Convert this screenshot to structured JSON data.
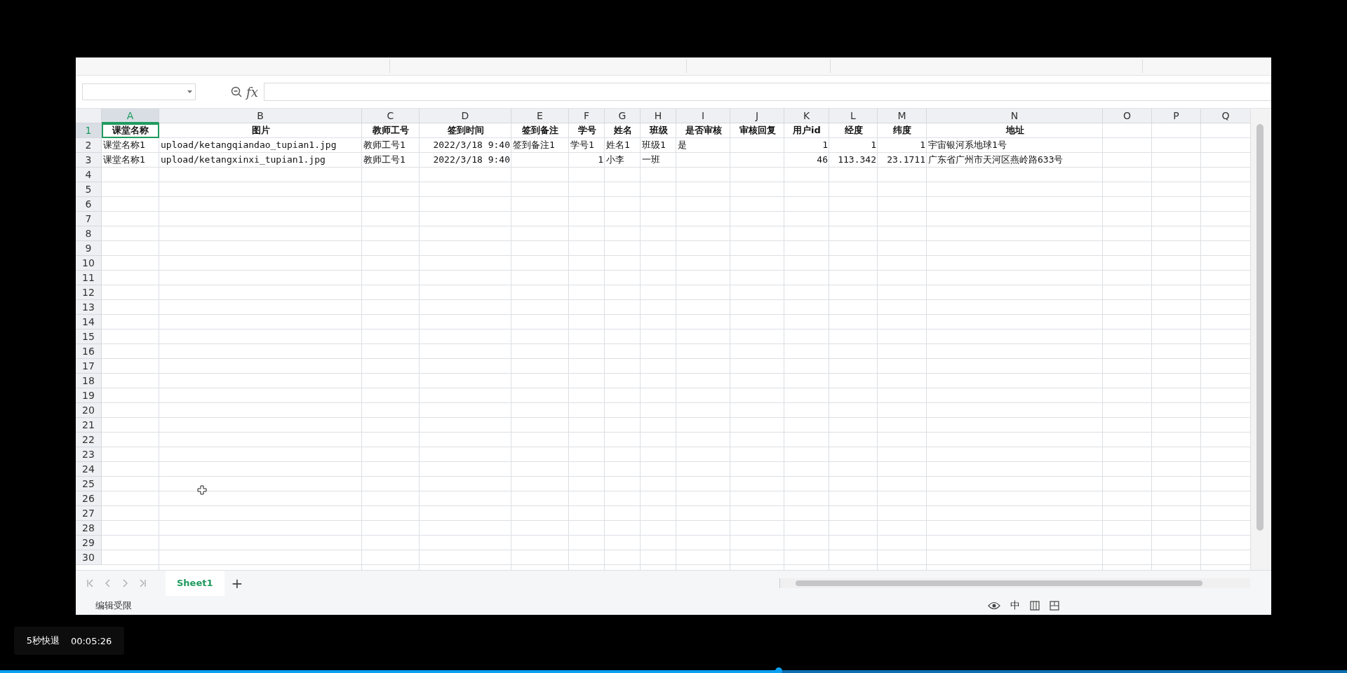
{
  "formula_bar": {
    "fx_label": "fx"
  },
  "sheet": {
    "columns": [
      {
        "letter": "A",
        "selected": true
      },
      {
        "letter": "B",
        "selected": false
      },
      {
        "letter": "C",
        "selected": false
      },
      {
        "letter": "D",
        "selected": false
      },
      {
        "letter": "E",
        "selected": false
      },
      {
        "letter": "F",
        "selected": false
      },
      {
        "letter": "G",
        "selected": false
      },
      {
        "letter": "H",
        "selected": false
      },
      {
        "letter": "I",
        "selected": false
      },
      {
        "letter": "J",
        "selected": false
      },
      {
        "letter": "K",
        "selected": false
      },
      {
        "letter": "L",
        "selected": false
      },
      {
        "letter": "M",
        "selected": false
      },
      {
        "letter": "N",
        "selected": false
      },
      {
        "letter": "O",
        "selected": false
      },
      {
        "letter": "P",
        "selected": false
      },
      {
        "letter": "Q",
        "selected": false
      }
    ],
    "rows": [
      {
        "number": "1",
        "selected": true,
        "cells": [
          {
            "text": "课堂名称",
            "kind": "header",
            "selected": true
          },
          {
            "text": "图片",
            "kind": "header",
            "selected": false
          },
          {
            "text": "教师工号",
            "kind": "header",
            "selected": false
          },
          {
            "text": "签到时间",
            "kind": "header",
            "selected": false
          },
          {
            "text": "签到备注",
            "kind": "header",
            "selected": false
          },
          {
            "text": "学号",
            "kind": "header",
            "selected": false
          },
          {
            "text": "姓名",
            "kind": "header",
            "selected": false
          },
          {
            "text": "班级",
            "kind": "header",
            "selected": false
          },
          {
            "text": "是否审核",
            "kind": "header",
            "selected": false
          },
          {
            "text": "审核回复",
            "kind": "header",
            "selected": false
          },
          {
            "text": "用户id",
            "kind": "header",
            "selected": false
          },
          {
            "text": "经度",
            "kind": "header",
            "selected": false
          },
          {
            "text": "纬度",
            "kind": "header",
            "selected": false
          },
          {
            "text": "地址",
            "kind": "header",
            "selected": false
          }
        ]
      },
      {
        "number": "2",
        "selected": false,
        "cells": [
          {
            "text": "课堂名称1",
            "kind": "text",
            "selected": false
          },
          {
            "text": "upload/ketangqiandao_tupian1.jpg",
            "kind": "text",
            "selected": false
          },
          {
            "text": "教师工号1",
            "kind": "text",
            "selected": false
          },
          {
            "text": "2022/3/18 9:40",
            "kind": "number",
            "selected": false
          },
          {
            "text": "签到备注1",
            "kind": "text",
            "selected": false
          },
          {
            "text": "学号1",
            "kind": "text",
            "selected": false
          },
          {
            "text": "姓名1",
            "kind": "text",
            "selected": false
          },
          {
            "text": "班级1",
            "kind": "text",
            "selected": false
          },
          {
            "text": "是",
            "kind": "text",
            "selected": false
          },
          null,
          {
            "text": "1",
            "kind": "number",
            "selected": false
          },
          {
            "text": "1",
            "kind": "number",
            "selected": false
          },
          {
            "text": "1",
            "kind": "number",
            "selected": false
          },
          {
            "text": "宇宙银河系地球1号",
            "kind": "text",
            "selected": false
          }
        ]
      },
      {
        "number": "3",
        "selected": false,
        "cells": [
          {
            "text": "课堂名称1",
            "kind": "text",
            "selected": false
          },
          {
            "text": "upload/ketangxinxi_tupian1.jpg",
            "kind": "text",
            "selected": false
          },
          {
            "text": "教师工号1",
            "kind": "text",
            "selected": false
          },
          {
            "text": "2022/3/18 9:40",
            "kind": "number",
            "selected": false
          },
          null,
          {
            "text": "1",
            "kind": "number",
            "selected": false
          },
          {
            "text": "小李",
            "kind": "text",
            "selected": false
          },
          {
            "text": "一班",
            "kind": "text",
            "selected": false
          },
          null,
          null,
          {
            "text": "46",
            "kind": "number",
            "selected": false
          },
          {
            "text": "113.342",
            "kind": "number",
            "selected": false
          },
          {
            "text": "23.1711",
            "kind": "number",
            "selected": false
          },
          {
            "text": "广东省广州市天河区燕岭路633号",
            "kind": "text",
            "selected": false
          }
        ]
      },
      {
        "number": "4",
        "selected": false
      },
      {
        "number": "5",
        "selected": false
      },
      {
        "number": "6",
        "selected": false
      },
      {
        "number": "7",
        "selected": false
      },
      {
        "number": "8",
        "selected": false
      },
      {
        "number": "9",
        "selected": false
      },
      {
        "number": "10",
        "selected": false
      },
      {
        "number": "11",
        "selected": false
      },
      {
        "number": "12",
        "selected": false
      },
      {
        "number": "13",
        "selected": false
      },
      {
        "number": "14",
        "selected": false
      },
      {
        "number": "15",
        "selected": false
      },
      {
        "number": "16",
        "selected": false
      },
      {
        "number": "17",
        "selected": false
      },
      {
        "number": "18",
        "selected": false
      },
      {
        "number": "19",
        "selected": false
      },
      {
        "number": "20",
        "selected": false
      },
      {
        "number": "21",
        "selected": false
      },
      {
        "number": "22",
        "selected": false
      },
      {
        "number": "23",
        "selected": false
      },
      {
        "number": "24",
        "selected": false
      },
      {
        "number": "25",
        "selected": false
      },
      {
        "number": "26",
        "selected": false
      },
      {
        "number": "27",
        "selected": false
      },
      {
        "number": "28",
        "selected": false
      },
      {
        "number": "29",
        "selected": false
      },
      {
        "number": "30",
        "selected": false
      }
    ]
  },
  "sheet_tabs": [
    {
      "label": "Sheet1",
      "selected": true
    }
  ],
  "add_sheet": "+",
  "status_bar": {
    "text": "编辑受限",
    "input_mode": "中"
  },
  "player": {
    "seek_label": "5秒快退",
    "time": "00:05:26",
    "progress": {
      "level": 0.578
    }
  }
}
